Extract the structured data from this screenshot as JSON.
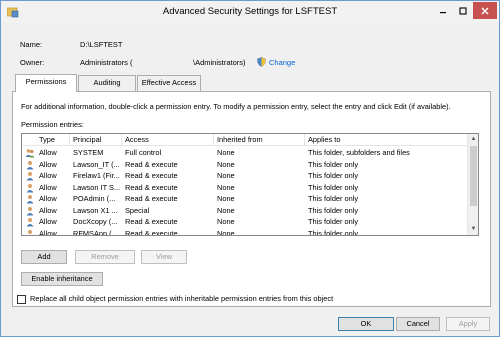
{
  "window": {
    "title": "Advanced Security Settings for LSFTEST"
  },
  "name_label": "Name:",
  "name_value": "D:\\LSFTEST",
  "owner_label": "Owner:",
  "owner_value_1": "Administrators (",
  "owner_value_2": "\\Administrators)",
  "change_label": "Change",
  "tabs": [
    "Permissions",
    "Auditing",
    "Effective Access"
  ],
  "info_text": "For additional information, double-click a permission entry. To modify a permission entry, select the entry and click Edit (if available).",
  "entries_label": "Permission entries:",
  "columns": [
    "Type",
    "Principal",
    "Access",
    "Inherited from",
    "Applies to"
  ],
  "rows": [
    {
      "type": "Allow",
      "principal": "SYSTEM",
      "access": "Full control",
      "inherited": "None",
      "applies": "This folder, subfolders and files",
      "icon": "users-icon"
    },
    {
      "type": "Allow",
      "principal": "Lawson_IT (...",
      "access": "Read & execute",
      "inherited": "None",
      "applies": "This folder only",
      "icon": "user-icon"
    },
    {
      "type": "Allow",
      "principal": "Firelaw1 (Fir...",
      "access": "Read & execute",
      "inherited": "None",
      "applies": "This folder only",
      "icon": "user-icon"
    },
    {
      "type": "Allow",
      "principal": "Lawson IT S...",
      "access": "Read & execute",
      "inherited": "None",
      "applies": "This folder only",
      "icon": "user-icon"
    },
    {
      "type": "Allow",
      "principal": "POAdmin (...",
      "access": "Read & execute",
      "inherited": "None",
      "applies": "This folder only",
      "icon": "user-icon"
    },
    {
      "type": "Allow",
      "principal": "Lawson X1 ...",
      "access": "Special",
      "inherited": "None",
      "applies": "This folder only",
      "icon": "user-icon"
    },
    {
      "type": "Allow",
      "principal": "DocXcopy (...",
      "access": "Read & execute",
      "inherited": "None",
      "applies": "This folder only",
      "icon": "user-icon"
    },
    {
      "type": "Allow",
      "principal": "RFMSApp (...",
      "access": "Read & execute",
      "inherited": "None",
      "applies": "This folder only",
      "icon": "user-icon"
    }
  ],
  "buttons": {
    "add": "Add",
    "remove": "Remove",
    "view": "View",
    "enable_inheritance": "Enable inheritance",
    "ok": "OK",
    "cancel": "Cancel",
    "apply": "Apply"
  },
  "replace_checkbox_label": "Replace all child object permission entries with inheritable permission entries from this object",
  "colors": {
    "link": "#0066cc",
    "close_button": "#c75050",
    "window_border": "#6b9bd2"
  }
}
